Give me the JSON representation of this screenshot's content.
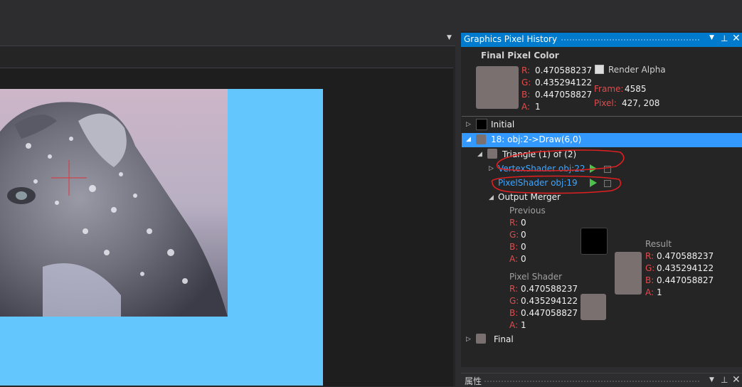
{
  "panel": {
    "title": "Graphics Pixel History",
    "final_label": "Final Pixel Color",
    "final": {
      "r_label": "R:",
      "r": "0.470588237",
      "g_label": "G:",
      "g": "0.435294122",
      "b_label": "B:",
      "b": "0.447058827",
      "a_label": "A:",
      "a": "1"
    },
    "render_alpha": "Render Alpha",
    "frame_label": "Frame:",
    "frame_value": "4585",
    "pixel_label": "Pixel:",
    "pixel_value": "427, 208",
    "swatch_color": "#7a7070"
  },
  "tree": {
    "initial": "Initial",
    "draw": "18: obj:2->Draw(6,0)",
    "triangle": "Triangle (1) of (2)",
    "vertex_shader": "VertexShader obj:22",
    "pixel_shader": "PixelShader obj:19",
    "output_merger": "Output Merger",
    "final": "Final"
  },
  "merger": {
    "previous_label": "Previous",
    "previous": {
      "r_label": "R:",
      "r": "0",
      "g_label": "G:",
      "g": "0",
      "b_label": "B:",
      "b": "0",
      "a_label": "A:",
      "a": "0"
    },
    "pixel_shader_label": "Pixel Shader",
    "ps": {
      "r_label": "R:",
      "r": "0.470588237",
      "g_label": "G:",
      "g": "0.435294122",
      "b_label": "B:",
      "b": "0.447058827",
      "a_label": "A:",
      "a": "1"
    },
    "result_label": "Result",
    "result": {
      "r_label": "R:",
      "r": "0.470588237",
      "g_label": "G:",
      "g": "0.435294122",
      "b_label": "B:",
      "b": "0.447058827",
      "a_label": "A:",
      "a": "1"
    }
  },
  "bottom_panel": {
    "title": "属性"
  },
  "colors": {
    "accent": "#007acc",
    "selection": "#3399ff",
    "canvas": "#63c6fc",
    "link": "#3ea6ff",
    "play": "#4cc14c",
    "label_red": "#e34a4a"
  }
}
